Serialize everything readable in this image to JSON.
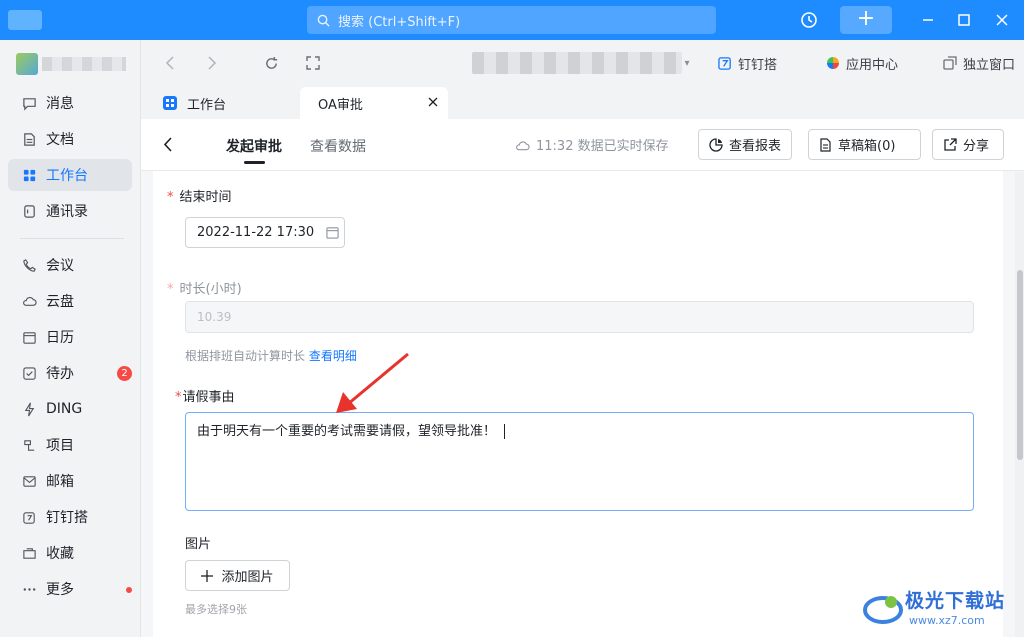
{
  "titlebar": {
    "search_placeholder": "搜索 (Ctrl+Shift+F)",
    "add_label": "+"
  },
  "sidebar": {
    "items": [
      {
        "label": "消息",
        "icon": "chat-icon"
      },
      {
        "label": "文档",
        "icon": "document-icon"
      },
      {
        "label": "工作台",
        "icon": "grid-icon",
        "active": true
      },
      {
        "label": "通讯录",
        "icon": "contacts-icon"
      },
      {
        "label": "会议",
        "icon": "phone-icon"
      },
      {
        "label": "云盘",
        "icon": "cloud-icon"
      },
      {
        "label": "日历",
        "icon": "calendar-icon"
      },
      {
        "label": "待办",
        "icon": "todo-icon",
        "badge": "2"
      },
      {
        "label": "DING",
        "icon": "lightning-icon"
      },
      {
        "label": "项目",
        "icon": "project-icon"
      },
      {
        "label": "邮箱",
        "icon": "mail-icon"
      },
      {
        "label": "钉钉搭",
        "icon": "builder-icon"
      },
      {
        "label": "收藏",
        "icon": "favorite-icon"
      },
      {
        "label": "更多",
        "icon": "more-icon",
        "dot": true
      }
    ]
  },
  "browser": {
    "links": [
      {
        "label": "钉钉搭",
        "icon": "builder-icon"
      },
      {
        "label": "应用中心",
        "icon": "app-center-icon"
      },
      {
        "label": "独立窗口",
        "icon": "window-icon"
      }
    ]
  },
  "tabs": [
    {
      "label": "工作台",
      "active": false
    },
    {
      "label": "OA审批",
      "active": true
    }
  ],
  "header": {
    "tabs": [
      "发起审批",
      "查看数据"
    ],
    "active_tab": "发起审批",
    "save_status": "11:32 数据已实时保存",
    "buttons": [
      "查看报表",
      "草稿箱(0)",
      "分享"
    ]
  },
  "form": {
    "end_time": {
      "label": "结束时间",
      "required": true,
      "value": "2022-11-22 17:30"
    },
    "duration": {
      "label": "时长(小时)",
      "required": true,
      "value": "10.39",
      "hint": "根据排班自动计算时长",
      "hint_link": "查看明细"
    },
    "reason": {
      "label": "请假事由",
      "required": true,
      "value": "由于明天有一个重要的考试需要请假，望领导批准！"
    },
    "images": {
      "label": "图片",
      "button": "添加图片",
      "hint": "最多选择9张"
    }
  },
  "watermark": {
    "title": "极光下载站",
    "url": "www.xz7.com"
  },
  "colors": {
    "brand_blue": "#1e8cff",
    "link_blue": "#1677ff",
    "required_red": "#f54a45",
    "arrow_red": "#e8332c"
  }
}
